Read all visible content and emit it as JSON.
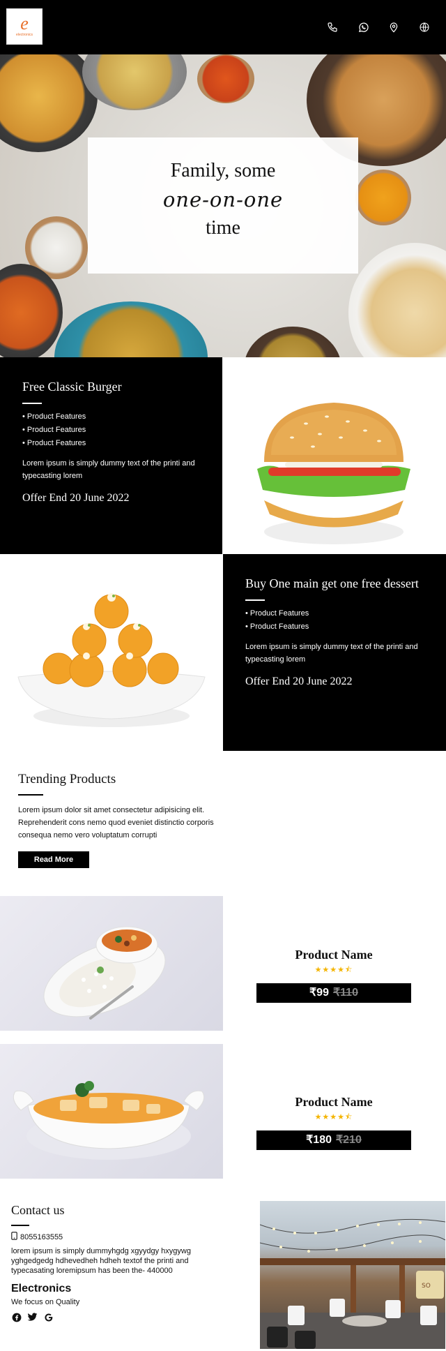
{
  "brand": {
    "logo_mark": "e",
    "logo_text": "electronics"
  },
  "header": {
    "icons": [
      "phone-icon",
      "whatsapp-icon",
      "location-icon",
      "globe-icon"
    ]
  },
  "hero": {
    "line1": "Family, some",
    "line2": "one-on-one",
    "line3": "time"
  },
  "offer1": {
    "title": "Free Classic Burger",
    "features": [
      "Product Features",
      "Product Features",
      "Product Features"
    ],
    "description": "Lorem ipsum is simply dummy text of the printi and typecasting lorem",
    "offer_end": "Offer End 20 June 2022"
  },
  "offer2": {
    "title": "Buy One main get one free dessert",
    "features": [
      "Product Features",
      "Product Features"
    ],
    "description": "Lorem ipsum is simply dummy text of the printi and typecasting lorem",
    "offer_end": "Offer End 20 June 2022"
  },
  "trending": {
    "title": "Trending Products",
    "description": "Lorem ipsum dolor sit amet consectetur adipisicing elit. Reprehenderit cons nemo quod eveniet distinctio corporis consequa nemo vero voluptatum corrupti",
    "button": "Read More"
  },
  "products": [
    {
      "name": "Product Name",
      "rating": 4.5,
      "stars": "★★★★⯪",
      "price": "₹99",
      "old_price": "₹110"
    },
    {
      "name": "Product Name",
      "rating": 4.5,
      "stars": "★★★★⯪",
      "price": "₹180",
      "old_price": "₹210"
    }
  ],
  "contact": {
    "title": "Contact us",
    "phone": "8055163555",
    "address": "lorem ipsum is simply dummyhgdg xgyydgy hxygywg yghgedgedg hdhevedheh hdheh textof the printi and typecasating loremipsum has been the- 440000",
    "brand": "Electronics",
    "tagline": "We focus on Quality",
    "socials": [
      "facebook-icon",
      "twitter-icon",
      "google-icon"
    ]
  },
  "colors": {
    "accent": "#e8702a",
    "black": "#000000",
    "star": "#f4b400"
  }
}
